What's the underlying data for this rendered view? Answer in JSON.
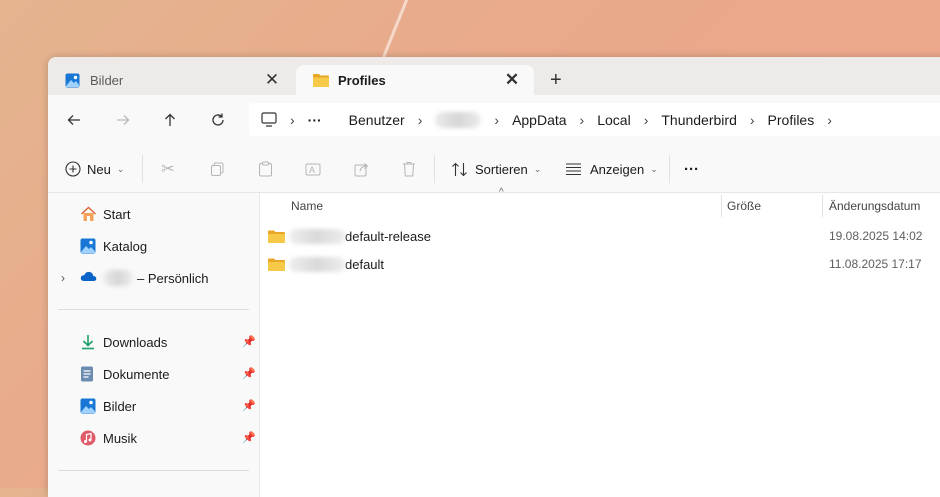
{
  "tabs": [
    {
      "label": "Bilder",
      "icon": "image-icon"
    },
    {
      "label": "Profiles",
      "icon": "folder-icon"
    }
  ],
  "newtab_glyph": "+",
  "close_glyph": "✕",
  "address": {
    "crumbs": [
      "Benutzer",
      "AppData",
      "Local",
      "Thunderbird",
      "Profiles"
    ],
    "overflow_glyph": "···"
  },
  "toolbar": {
    "new_label": "Neu",
    "sort_label": "Sortieren",
    "view_label": "Anzeigen",
    "more_glyph": "···"
  },
  "sidebar": {
    "top_items": [
      {
        "label": "Start",
        "icon": "home-icon"
      },
      {
        "label": "Katalog",
        "icon": "gallery-icon"
      },
      {
        "label": "– Persönlich",
        "icon": "onedrive-cloud-icon"
      }
    ],
    "quick_items": [
      {
        "label": "Downloads",
        "icon": "download-icon"
      },
      {
        "label": "Dokumente",
        "icon": "document-icon"
      },
      {
        "label": "Bilder",
        "icon": "pictures-icon"
      },
      {
        "label": "Musik",
        "icon": "music-icon"
      }
    ]
  },
  "columns": {
    "name": "Name",
    "size": "Größe",
    "date": "Änderungsdatum"
  },
  "files": [
    {
      "name": "default-release",
      "date": "19.08.2025 14:02"
    },
    {
      "name": "default",
      "date": "11.08.2025 17:17"
    }
  ],
  "colors": {
    "folder": "#f7c948",
    "accent": "#0a64c8",
    "download": "#1e9e6a",
    "music": "#e05a6a"
  }
}
